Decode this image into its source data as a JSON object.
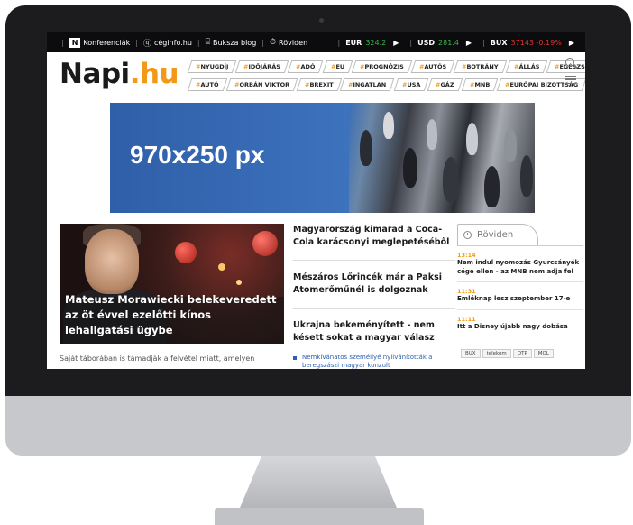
{
  "topbar": {
    "links": [
      "Konferenciák",
      "céginfo.hu",
      "Buksza blog",
      "Röviden"
    ],
    "n_badge": "N",
    "tickers": [
      {
        "label": "EUR",
        "value": "324.2",
        "color": "#39b54a"
      },
      {
        "label": "USD",
        "value": "281.4",
        "color": "#39b54a"
      },
      {
        "label": "BUX",
        "value": "37143 -0.19%",
        "color": "#e0312b"
      }
    ]
  },
  "header": {
    "logo_main": "Napi",
    "logo_tld": ".hu",
    "tags_row1": [
      "NYUGDÍJ",
      "IDŐJÁRÁS",
      "ADÓ",
      "EU",
      "PROGNÓZIS",
      "AUTÓS",
      "BOTRÁNY",
      "ÁLLÁS",
      "EGÉSZSÉG"
    ],
    "tags_row2": [
      "AUTÓ",
      "ORBÁN VIKTOR",
      "BREXIT",
      "INGATLAN",
      "USA",
      "GÁZ",
      "MNB",
      "EURÓPAI BIZOTTSÁG"
    ],
    "hash": "#"
  },
  "banner": {
    "text": "970x250 px"
  },
  "feature": {
    "title": "Mateusz Morawiecki belekeveredett az öt évvel ezelőtti kínos lehallgatási ügybe",
    "lead": "Saját táborában is támadják a felvétel miatt, amelyen"
  },
  "middle": {
    "articles": [
      "Magyarország kimarad a Coca-Cola karácsonyi meglepetéséből",
      "Mészáros Lőrincék már a Paksi Atomerőműnél is dolgoznak",
      "Ukrajna bekeményített - nem késett sokat a magyar válasz"
    ],
    "bullet": "Nemkívánatos személlyé nyilvánították a beregszászi magyar konzult"
  },
  "right": {
    "tab_label": "Röviden",
    "news": [
      {
        "time": "13:14",
        "text": "Nem indul nyomozás Gyurcsányék cége ellen - az MNB nem adja fel"
      },
      {
        "time": "11:31",
        "text": "Emléknap lesz szeptember 17-e"
      },
      {
        "time": "11:11",
        "text": "Itt a Disney újabb nagy dobása"
      }
    ],
    "market_tabs": [
      "BUX",
      "telekom",
      "OTP",
      "MOL"
    ]
  }
}
